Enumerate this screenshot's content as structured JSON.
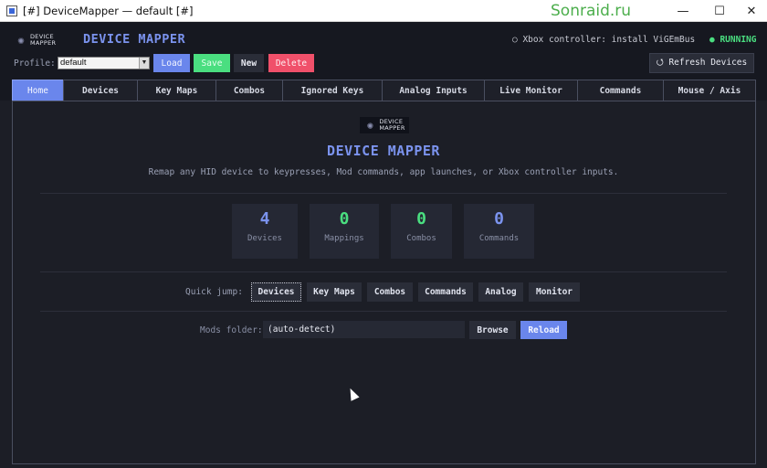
{
  "window": {
    "title": "[#] DeviceMapper — default [#]",
    "watermark": "Sonraid.ru",
    "minimize": "—",
    "maximize": "☐",
    "close": "✕"
  },
  "header": {
    "logo_line1": "DEVICE",
    "logo_line2": "MAPPER",
    "title": "DEVICE MAPPER",
    "xbox_status": "○ Xbox controller: install ViGEmBus",
    "running_status": "● RUNNING",
    "running_color": "#4ade80"
  },
  "profile": {
    "label": "Profile:",
    "selected": "default",
    "buttons": {
      "load": "Load",
      "save": "Save",
      "new": "New",
      "delete": "Delete"
    },
    "refresh": "⭯ Refresh Devices"
  },
  "tabs": [
    {
      "label": "Home",
      "active": true
    },
    {
      "label": "Devices"
    },
    {
      "label": "Key Maps"
    },
    {
      "label": "Combos"
    },
    {
      "label": "Ignored Keys"
    },
    {
      "label": "Analog Inputs"
    },
    {
      "label": "Live Monitor"
    },
    {
      "label": "Commands"
    },
    {
      "label": "Mouse / Axis"
    }
  ],
  "home": {
    "title": "DEVICE MAPPER",
    "subtitle": "Remap any HID device to keypresses, Mod commands, app launches, or Xbox controller inputs.",
    "stats": [
      {
        "value": "4",
        "label": "Devices",
        "color": "#7b93ee"
      },
      {
        "value": "0",
        "label": "Mappings",
        "color": "#4ade80"
      },
      {
        "value": "0",
        "label": "Combos",
        "color": "#4ade80"
      },
      {
        "value": "0",
        "label": "Commands",
        "color": "#7b93ee"
      }
    ],
    "quick_jump_label": "Quick jump:",
    "quick_jump": [
      "Devices",
      "Key Maps",
      "Combos",
      "Commands",
      "Analog",
      "Monitor"
    ],
    "mods_folder_label": "Mods folder:",
    "mods_folder_value": "(auto-detect)",
    "browse": "Browse",
    "reload": "Reload"
  },
  "colors": {
    "accent": "#6a86ec",
    "success": "#4ade80",
    "danger": "#f0506a",
    "background": "#1c1e26"
  }
}
